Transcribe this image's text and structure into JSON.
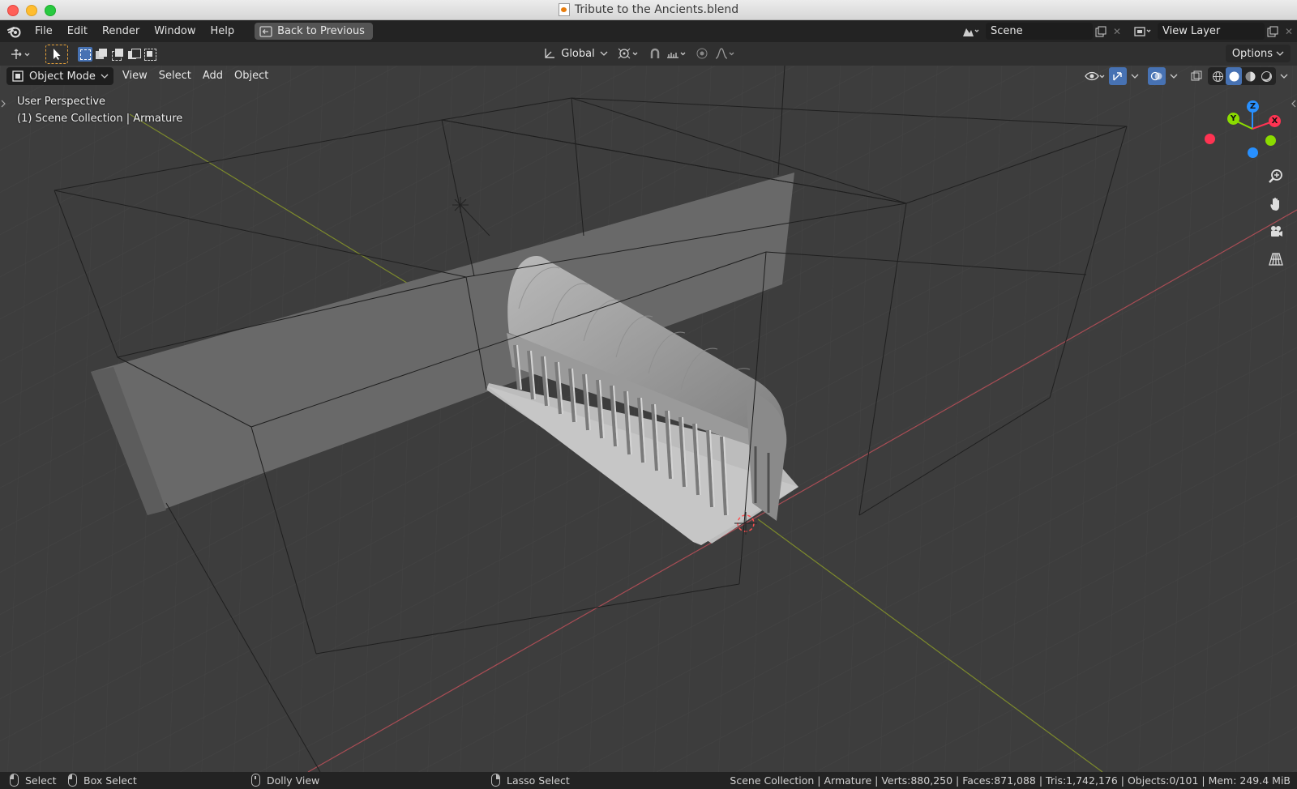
{
  "window": {
    "title": "Tribute to the Ancients.blend"
  },
  "topbar": {
    "menus": [
      "File",
      "Edit",
      "Render",
      "Window",
      "Help"
    ],
    "back_button": "Back to Previous",
    "scene_name": "Scene",
    "view_layer_name": "View Layer"
  },
  "toolheader": {
    "orientation": "Global",
    "options_label": "Options"
  },
  "viewport": {
    "mode": "Object Mode",
    "menus": [
      "View",
      "Select",
      "Add",
      "Object"
    ],
    "perspective_label": "User Perspective",
    "collection_label": "(1) Scene Collection | Armature",
    "gizmo": {
      "x": "X",
      "y": "Y",
      "z": "Z"
    },
    "colors": {
      "x_axis": "#ff3352",
      "y_axis": "#8bdc00",
      "z_axis": "#2890ff",
      "background": "#3d3d3d",
      "grid": "#474747"
    }
  },
  "statusbar": {
    "select": "Select",
    "box_select": "Box Select",
    "dolly_view": "Dolly View",
    "lasso_select": "Lasso Select",
    "stats": "Scene Collection | Armature | Verts:880,250 | Faces:871,088 | Tris:1,742,176 | Objects:0/101 | Mem: 249.4 MiB"
  }
}
